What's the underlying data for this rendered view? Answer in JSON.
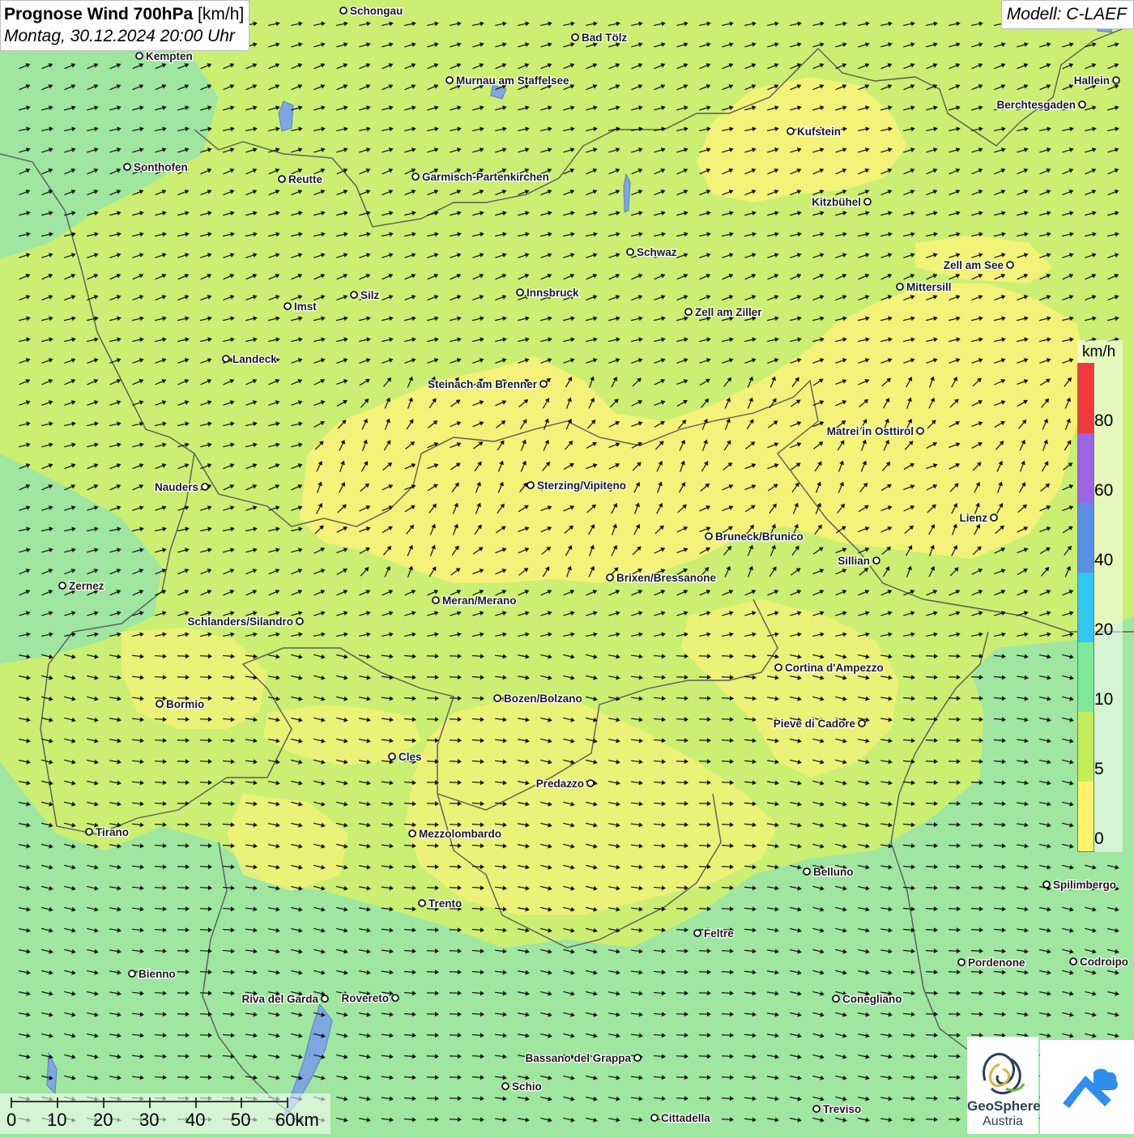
{
  "header": {
    "title_bold": "Prognose Wind 700hPa",
    "title_unit": "[km/h]",
    "date": "Montag, 30.12.2024 20:00 Uhr",
    "model": "Modell: C-LAEF"
  },
  "legend": {
    "unit": "km/h",
    "labels": [
      "80",
      "60",
      "40",
      "20",
      "10",
      "5",
      "0"
    ],
    "colors": [
      "#ee3a3a",
      "#9b63e6",
      "#5b8fe8",
      "#33c6f0",
      "#7de89a",
      "#c2ee5c",
      "#fdf36b"
    ]
  },
  "scale_bar": {
    "labels": [
      "0",
      "10",
      "20",
      "30",
      "40",
      "50",
      "60km"
    ]
  },
  "logo": {
    "name": "GeoSphere",
    "country": "Austria"
  },
  "map_colors": {
    "green": "#9fe6a0",
    "light_green": "#cbef72",
    "yellow": "#f7f27a",
    "border": "#5a5a5a",
    "arrow": "#111111"
  },
  "cities": [
    {
      "name": "Schongau",
      "label_side": "right"
    },
    {
      "name": "Bad Tölz",
      "label_side": "right"
    },
    {
      "name": "Kempten",
      "label_side": "right"
    },
    {
      "name": "Murnau am Staffelsee",
      "label_side": "right"
    },
    {
      "name": "Hallein",
      "label_side": "left"
    },
    {
      "name": "Berchtesgaden",
      "label_side": "left"
    },
    {
      "name": "Kufstein",
      "label_side": "right"
    },
    {
      "name": "Sonthofen",
      "label_side": "right"
    },
    {
      "name": "Reutte",
      "label_side": "right"
    },
    {
      "name": "Garmisch-Partenkirchen",
      "label_side": "right"
    },
    {
      "name": "Kitzbühel",
      "label_side": "left"
    },
    {
      "name": "Schwaz",
      "label_side": "right"
    },
    {
      "name": "Zell am See",
      "label_side": "left"
    },
    {
      "name": "Mittersill",
      "label_side": "right"
    },
    {
      "name": "Innsbruck",
      "label_side": "right"
    },
    {
      "name": "Silz",
      "label_side": "right"
    },
    {
      "name": "Imst",
      "label_side": "right"
    },
    {
      "name": "Zell am Ziller",
      "label_side": "right"
    },
    {
      "name": "Landeck",
      "label_side": "right"
    },
    {
      "name": "Steinach am Brenner",
      "label_side": "left"
    },
    {
      "name": "Matrei in Osttirol",
      "label_side": "left"
    },
    {
      "name": "Nauders",
      "label_side": "left"
    },
    {
      "name": "Sterzing/Vipiteno",
      "label_side": "right"
    },
    {
      "name": "Lienz",
      "label_side": "left"
    },
    {
      "name": "Bruneck/Brunico",
      "label_side": "right"
    },
    {
      "name": "Sillian",
      "label_side": "left"
    },
    {
      "name": "Brixen/Bressanone",
      "label_side": "right"
    },
    {
      "name": "Zernez",
      "label_side": "right"
    },
    {
      "name": "Meran/Merano",
      "label_side": "right"
    },
    {
      "name": "Schlanders/Silandro",
      "label_side": "left"
    },
    {
      "name": "Cortina d'Ampezzo",
      "label_side": "right"
    },
    {
      "name": "Bozen/Bolzano",
      "label_side": "right"
    },
    {
      "name": "Bormio",
      "label_side": "right"
    },
    {
      "name": "Pieve di Cadore",
      "label_side": "left"
    },
    {
      "name": "Cles",
      "label_side": "right"
    },
    {
      "name": "Predazzo",
      "label_side": "left"
    },
    {
      "name": "Tirano",
      "label_side": "right"
    },
    {
      "name": "Mezzolombardo",
      "label_side": "right"
    },
    {
      "name": "Belluno",
      "label_side": "right"
    },
    {
      "name": "Spilimbergo",
      "label_side": "right"
    },
    {
      "name": "Trento",
      "label_side": "right"
    },
    {
      "name": "Feltre",
      "label_side": "right"
    },
    {
      "name": "Pordenone",
      "label_side": "right"
    },
    {
      "name": "Codroipo",
      "label_side": "right"
    },
    {
      "name": "Bienno",
      "label_side": "right"
    },
    {
      "name": "Riva del Garda",
      "label_side": "left"
    },
    {
      "name": "Rovereto",
      "label_side": "left"
    },
    {
      "name": "Conegliano",
      "label_side": "right"
    },
    {
      "name": "Bassano del Grappa",
      "label_side": "left"
    },
    {
      "name": "Schio",
      "label_side": "right"
    },
    {
      "name": "Treviso",
      "label_side": "right"
    },
    {
      "name": "Cittadella",
      "label_side": "right"
    }
  ]
}
